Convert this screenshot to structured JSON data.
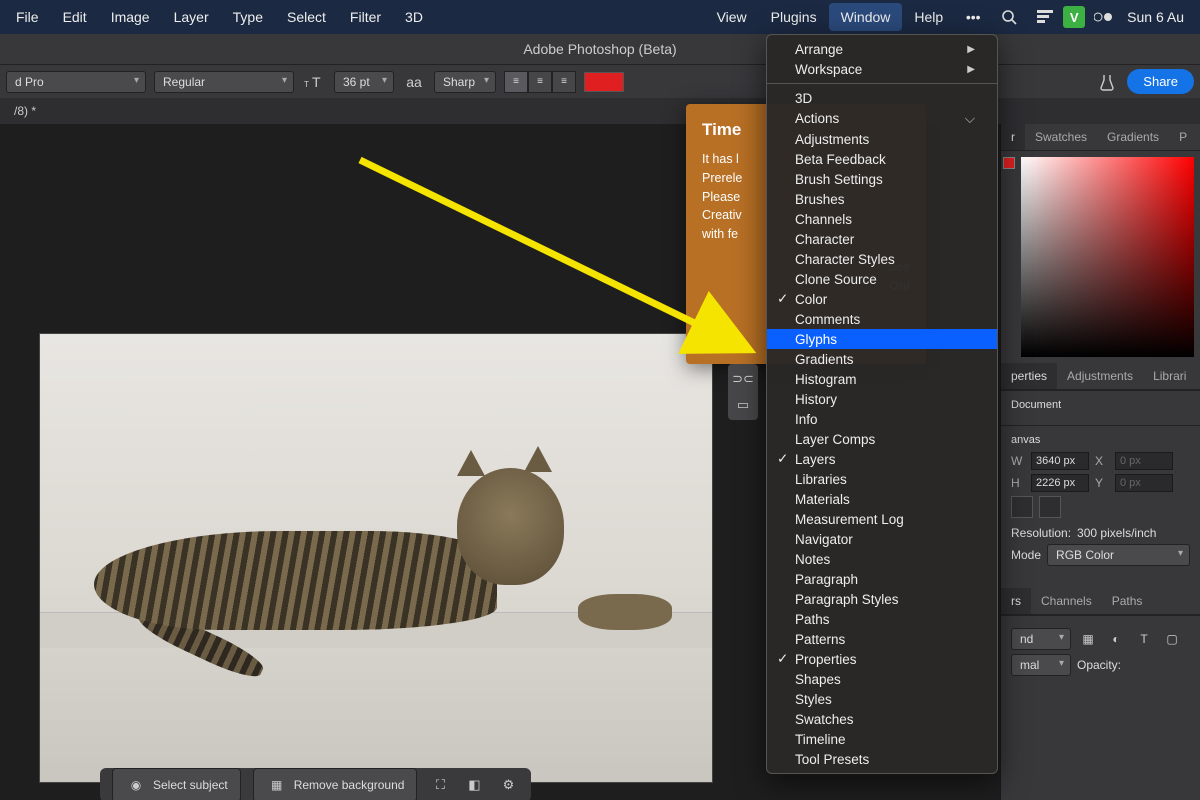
{
  "menubar": {
    "left": [
      "File",
      "Edit",
      "Image",
      "Layer",
      "Type",
      "Select",
      "Filter",
      "3D"
    ],
    "right": [
      "View",
      "Plugins",
      "Window",
      "Help"
    ],
    "active": "Window",
    "date": "Sun 6 Au",
    "v": "V"
  },
  "title": "Adobe Photoshop (Beta)",
  "options": {
    "font": "d Pro",
    "style": "Regular",
    "size": "36 pt",
    "aa_label": "aa",
    "aa": "Sharp"
  },
  "share": "Share",
  "doc_tab": "/8) *",
  "beta_dialog": {
    "title": "Time",
    "l1": "It has l",
    "l2": "Prerele",
    "l3": "Please",
    "l4": "Creativ",
    "l5": "with fe",
    "see": "See",
    "onl": "Onl"
  },
  "window_menu": {
    "top": [
      {
        "label": "Arrange",
        "arrow": true
      },
      {
        "label": "Workspace",
        "arrow": true
      }
    ],
    "items": [
      {
        "label": "3D"
      },
      {
        "label": "Actions",
        "shortcut": "⌵"
      },
      {
        "label": "Adjustments"
      },
      {
        "label": "Beta Feedback"
      },
      {
        "label": "Brush Settings"
      },
      {
        "label": "Brushes"
      },
      {
        "label": "Channels"
      },
      {
        "label": "Character"
      },
      {
        "label": "Character Styles"
      },
      {
        "label": "Clone Source"
      },
      {
        "label": "Color",
        "checked": true
      },
      {
        "label": "Comments"
      },
      {
        "label": "Glyphs",
        "selected": true
      },
      {
        "label": "Gradients"
      },
      {
        "label": "Histogram"
      },
      {
        "label": "History"
      },
      {
        "label": "Info"
      },
      {
        "label": "Layer Comps"
      },
      {
        "label": "Layers",
        "checked": true
      },
      {
        "label": "Libraries"
      },
      {
        "label": "Materials"
      },
      {
        "label": "Measurement Log"
      },
      {
        "label": "Navigator"
      },
      {
        "label": "Notes"
      },
      {
        "label": "Paragraph"
      },
      {
        "label": "Paragraph Styles"
      },
      {
        "label": "Paths"
      },
      {
        "label": "Patterns"
      },
      {
        "label": "Properties",
        "checked": true
      },
      {
        "label": "Shapes"
      },
      {
        "label": "Styles"
      },
      {
        "label": "Swatches"
      },
      {
        "label": "Timeline"
      },
      {
        "label": "Tool Presets"
      }
    ]
  },
  "panels": {
    "color_tabs": [
      "r",
      "Swatches",
      "Gradients",
      "P"
    ],
    "prop_tabs": [
      "perties",
      "Adjustments",
      "Librari"
    ],
    "doc_label": "Document",
    "canvas_label": "anvas",
    "w_label": "W",
    "w_val": "3640 px",
    "h_label": "H",
    "h_val": "2226 px",
    "x_label": "X",
    "x_val": "0 px",
    "y_label": "Y",
    "y_val": "0 px",
    "res_label": "Resolution:",
    "res_val": "300 pixels/inch",
    "mode_label": "Mode",
    "mode_val": "RGB Color",
    "layer_tabs": [
      "rs",
      "Channels",
      "Paths"
    ],
    "blend_val": "nd",
    "blend_mal": "mal",
    "opacity_label": "Opacity:"
  },
  "bottom": {
    "select_subject": "Select subject",
    "remove_bg": "Remove background"
  }
}
